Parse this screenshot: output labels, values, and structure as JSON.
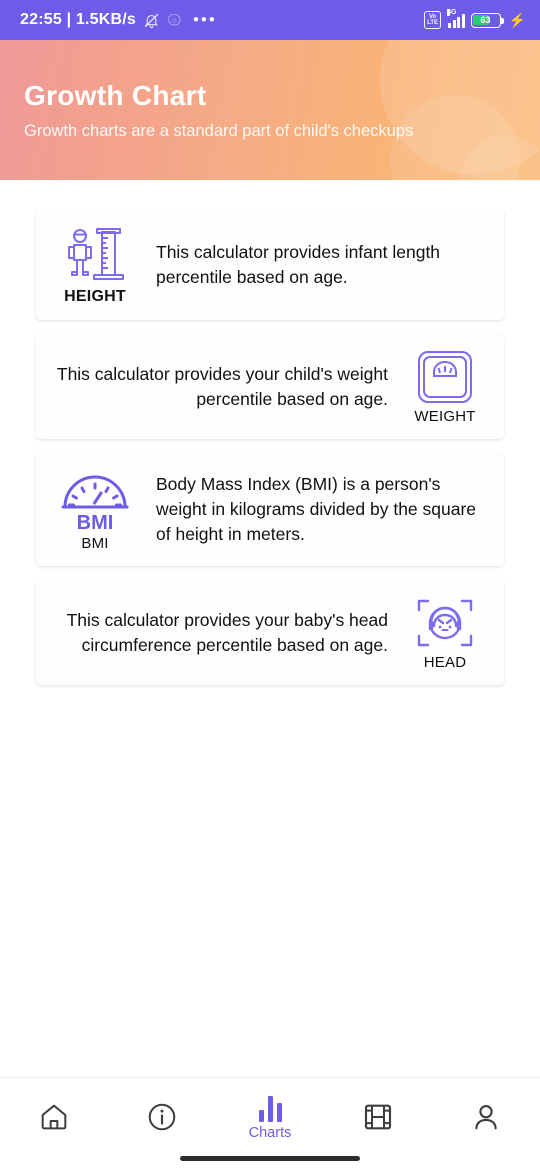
{
  "status_bar": {
    "time_and_speed": "22:55 | 1.5KB/s",
    "overflow_dots": "•••",
    "volte_line1": "Vo",
    "volte_line2": "LTE",
    "network_type": "4G",
    "battery_percent": "63",
    "charging_glyph": "⚡",
    "background_color": "#6c5ce7"
  },
  "header": {
    "title": "Growth Chart",
    "subtitle": "Growth charts are a standard part of child's checkups",
    "gradient_from": "#ef9a9a",
    "gradient_to": "#fbbd7e"
  },
  "theme": {
    "accent": "#6c5ce7",
    "icon_stroke": "#7b6cf0",
    "text": "#111111",
    "page_background": "#ffffff"
  },
  "cards": [
    {
      "id": "height",
      "icon": "height-ruler-icon",
      "icon_label": "HEIGHT",
      "text": "This calculator provides infant length percentile based on age.",
      "layout": "icon-left"
    },
    {
      "id": "weight",
      "icon": "weight-scale-icon",
      "icon_label": "WEIGHT",
      "text": "This calculator provides your child's weight percentile based on age.",
      "layout": "icon-right"
    },
    {
      "id": "bmi",
      "icon": "bmi-gauge-icon",
      "icon_label": "BMI",
      "icon_inner_text": "BMI",
      "text": "Body Mass Index (BMI) is a person's weight in kilograms divided by the square of height in meters.",
      "layout": "icon-left"
    },
    {
      "id": "head",
      "icon": "head-circumference-icon",
      "icon_label": "HEAD",
      "text": "This calculator provides your baby's head circumference percentile based on age.",
      "layout": "icon-right"
    }
  ],
  "bottom_nav": {
    "items": [
      {
        "id": "home",
        "icon": "home-icon",
        "label": "",
        "active": false
      },
      {
        "id": "info",
        "icon": "info-icon",
        "label": "",
        "active": false
      },
      {
        "id": "charts",
        "icon": "bar-chart-icon",
        "label": "Charts",
        "active": true
      },
      {
        "id": "videos",
        "icon": "film-icon",
        "label": "",
        "active": false
      },
      {
        "id": "profile",
        "icon": "person-icon",
        "label": "",
        "active": false
      }
    ]
  }
}
